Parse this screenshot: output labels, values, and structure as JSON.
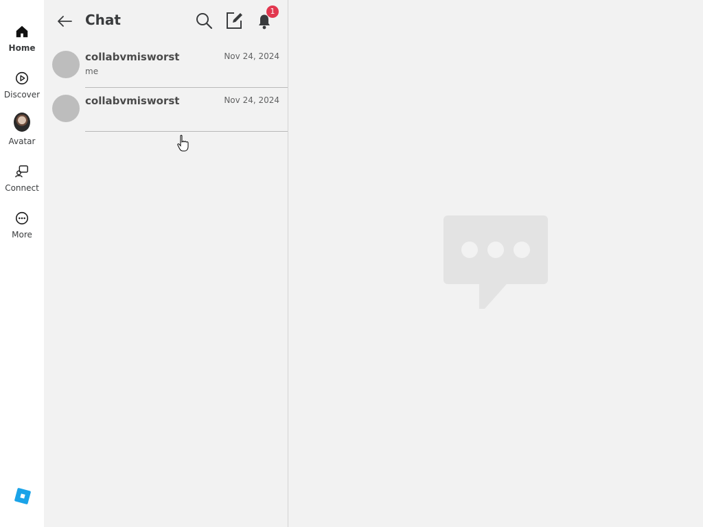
{
  "nav": {
    "items": [
      {
        "label": "Home",
        "icon": "home-icon",
        "active": true
      },
      {
        "label": "Discover",
        "icon": "play-circle-icon"
      },
      {
        "label": "Avatar",
        "icon": "avatar-icon"
      },
      {
        "label": "Connect",
        "icon": "connect-icon"
      },
      {
        "label": "More",
        "icon": "more-icon"
      }
    ],
    "brand_icon": "roblox-logo-icon"
  },
  "chat": {
    "title": "Chat",
    "notification_count": "1",
    "conversations": [
      {
        "name": "collabvmisworst",
        "date": "Nov 24, 2024",
        "preview": "me"
      },
      {
        "name": "collabvmisworst",
        "date": "Nov 24, 2024",
        "preview": ""
      }
    ]
  },
  "colors": {
    "badge": "#e2374f",
    "brand": "#1aa3e8",
    "panel_bg": "#f2f2f2"
  }
}
